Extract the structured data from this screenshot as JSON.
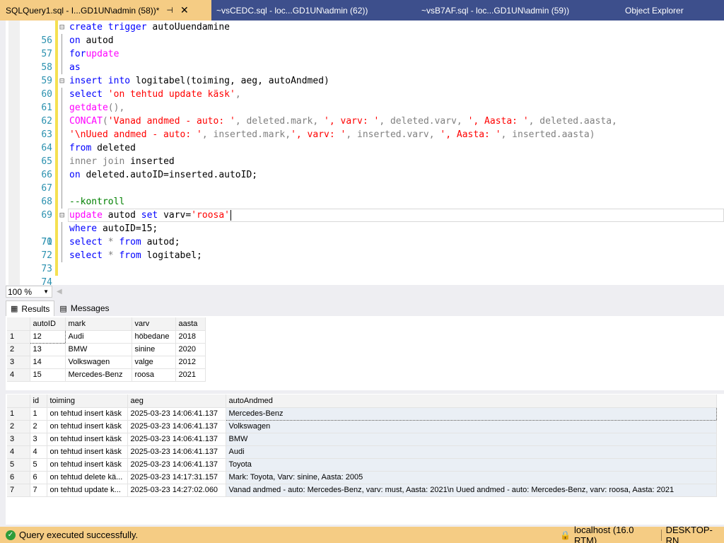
{
  "tabs": [
    {
      "label": "SQLQuery1.sql - I...GD1UN\\admin (58))*",
      "active": true
    },
    {
      "label": "~vsCEDC.sql - loc...GD1UN\\admin (62))"
    },
    {
      "label": "~vsB7AF.sql - loc...GD1UN\\admin (59))"
    },
    {
      "label": "Object Explorer"
    }
  ],
  "editor": {
    "lines": [
      {
        "n": "56"
      },
      {
        "n": "57"
      },
      {
        "n": "58"
      },
      {
        "n": "59"
      },
      {
        "n": "60"
      },
      {
        "n": "61"
      },
      {
        "n": "62"
      },
      {
        "n": "63"
      },
      {
        "n": "64"
      },
      {
        "n": "65"
      },
      {
        "n": "66"
      },
      {
        "n": "67"
      },
      {
        "n": "68"
      },
      {
        "n": "69"
      },
      {
        "n": "70"
      },
      {
        "n": "71"
      },
      {
        "n": "72"
      },
      {
        "n": "73"
      },
      {
        "n": "74"
      }
    ],
    "t": {
      "create_trigger": "create trigger",
      "trigger_name": " autoUuendamine",
      "on": "on",
      "autod": " autod",
      "for": "for",
      "update": "update",
      "as": "as",
      "insert_into": "insert into",
      "logitabel_cols": " logitabel(toiming, aeg, autoAndmed)",
      "select": "select",
      "sp": " ",
      "str61": "'on tehtud update käsk'",
      "comma": ",",
      "getdate": "getdate",
      "paren_comma": "(),",
      "concat": "CONCAT",
      "open": "(",
      "s63a": "'Vanad andmed - auto: '",
      "c63a": ", deleted.mark, ",
      "s63b": "', varv: '",
      "c63b": ", deleted.varv, ",
      "s63c": "', Aasta: '",
      "c63c": ", deleted.aasta,",
      "s64a": "'\\nUued andmed - auto: '",
      "c64a": ", inserted.mark,",
      "s64b": "', varv: '",
      "c64b": ", inserted.varv, ",
      "s64c": "', Aasta: '",
      "c64c": ", inserted.aasta)",
      "from": "from",
      "deleted": " deleted",
      "inner_join": "inner join",
      "inserted": " inserted",
      "on2": "on",
      "join_cond": " deleted.autoID=inserted.autoID;",
      "comment": "--kontroll",
      "autod_set": " autod ",
      "set": "set",
      "varv_eq": " varv=",
      "roosa": "'roosa'",
      "where": "where",
      "where_cond": " autoID=15;",
      "select72": "select",
      "star": " * ",
      "from72": "from",
      "autod72": " autod;",
      "select73": "select",
      "star73": " * ",
      "from73": "from",
      "logitabel73": " logitabel;"
    }
  },
  "zoom": "100 %",
  "result_tabs": {
    "results": "Results",
    "messages": "Messages"
  },
  "grid1": {
    "headers": [
      "autoID",
      "mark",
      "varv",
      "aasta"
    ],
    "rows": [
      {
        "n": "1",
        "c": [
          "12",
          "Audi",
          "höbedane",
          "2018"
        ]
      },
      {
        "n": "2",
        "c": [
          "13",
          "BMW",
          "sinine",
          "2020"
        ]
      },
      {
        "n": "3",
        "c": [
          "14",
          "Volkswagen",
          "valge",
          "2012"
        ]
      },
      {
        "n": "4",
        "c": [
          "15",
          "Mercedes-Benz",
          "roosa",
          "2021"
        ]
      }
    ]
  },
  "grid2": {
    "headers": [
      "id",
      "toiming",
      "aeg",
      "autoAndmed"
    ],
    "rows": [
      {
        "n": "1",
        "c": [
          "1",
          "on tehtud insert käsk",
          "2025-03-23 14:06:41.137",
          "Mercedes-Benz"
        ]
      },
      {
        "n": "2",
        "c": [
          "2",
          "on tehtud insert käsk",
          "2025-03-23 14:06:41.137",
          "Volkswagen"
        ]
      },
      {
        "n": "3",
        "c": [
          "3",
          "on tehtud insert käsk",
          "2025-03-23 14:06:41.137",
          "BMW"
        ]
      },
      {
        "n": "4",
        "c": [
          "4",
          "on tehtud insert käsk",
          "2025-03-23 14:06:41.137",
          "Audi"
        ]
      },
      {
        "n": "5",
        "c": [
          "5",
          "on tehtud insert käsk",
          "2025-03-23 14:06:41.137",
          "Toyota"
        ]
      },
      {
        "n": "6",
        "c": [
          "6",
          "on tehtud delete kä...",
          "2025-03-23 14:17:31.157",
          "Mark: Toyota, Varv: sinine, Aasta: 2005"
        ]
      },
      {
        "n": "7",
        "c": [
          "7",
          "on tehtud update k...",
          "2025-03-23 14:27:02.060",
          "Vanad andmed - auto: Mercedes-Benz, varv: must, Aasta: 2021\\n Uued andmed - auto: Mercedes-Benz, varv: roosa, Aasta: 2021"
        ]
      }
    ]
  },
  "status": {
    "message": "Query executed successfully.",
    "server": "localhost (16.0 RTM)",
    "machine": "DESKTOP-RN"
  }
}
